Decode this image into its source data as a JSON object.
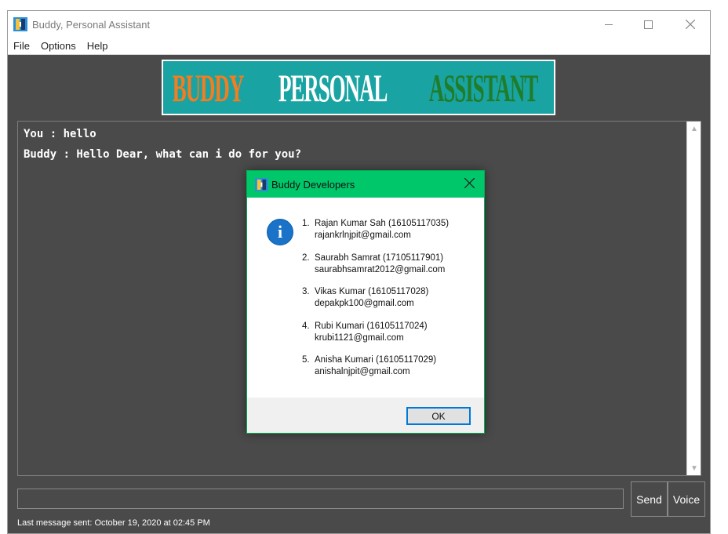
{
  "window": {
    "title": "Buddy, Personal Assistant"
  },
  "menu": {
    "items": [
      "File",
      "Options",
      "Help"
    ]
  },
  "banner": {
    "part1": "BUDDY",
    "part2": "PERSONAL",
    "part3": "ASSISTANT"
  },
  "chat": {
    "lines": [
      "You : hello",
      "Buddy : Hello Dear, what can i do for you?"
    ]
  },
  "input": {
    "value": "",
    "send_label": "Send",
    "voice_label": "Voice"
  },
  "status": {
    "text": "Last message sent: October 19, 2020 at 02:45 PM"
  },
  "dialog": {
    "title": "Buddy Developers",
    "ok_label": "OK",
    "developers": [
      {
        "num": "1.",
        "name": "Rajan Kumar Sah (16105117035)",
        "email": "rajankrlnjpit@gmail.com"
      },
      {
        "num": "2.",
        "name": "Saurabh Samrat (17105117901)",
        "email": "saurabhsamrat2012@gmail.com"
      },
      {
        "num": "3.",
        "name": "Vikas Kumar (16105117028)",
        "email": "depakpk100@gmail.com"
      },
      {
        "num": "4.",
        "name": "Rubi Kumari (16105117024)",
        "email": "krubi1121@gmail.com"
      },
      {
        "num": "5.",
        "name": " Anisha Kumari (16105117029)",
        "email": "anishalnjpit@gmail.com"
      }
    ]
  },
  "colors": {
    "window_bg": "#4a4a4a",
    "dialog_title_bg": "#00c86a",
    "banner_bg": "#1aa3a3",
    "banner_orange": "#f57c1f",
    "banner_green": "#1f7d2a",
    "info_blue": "#1a73c8"
  }
}
